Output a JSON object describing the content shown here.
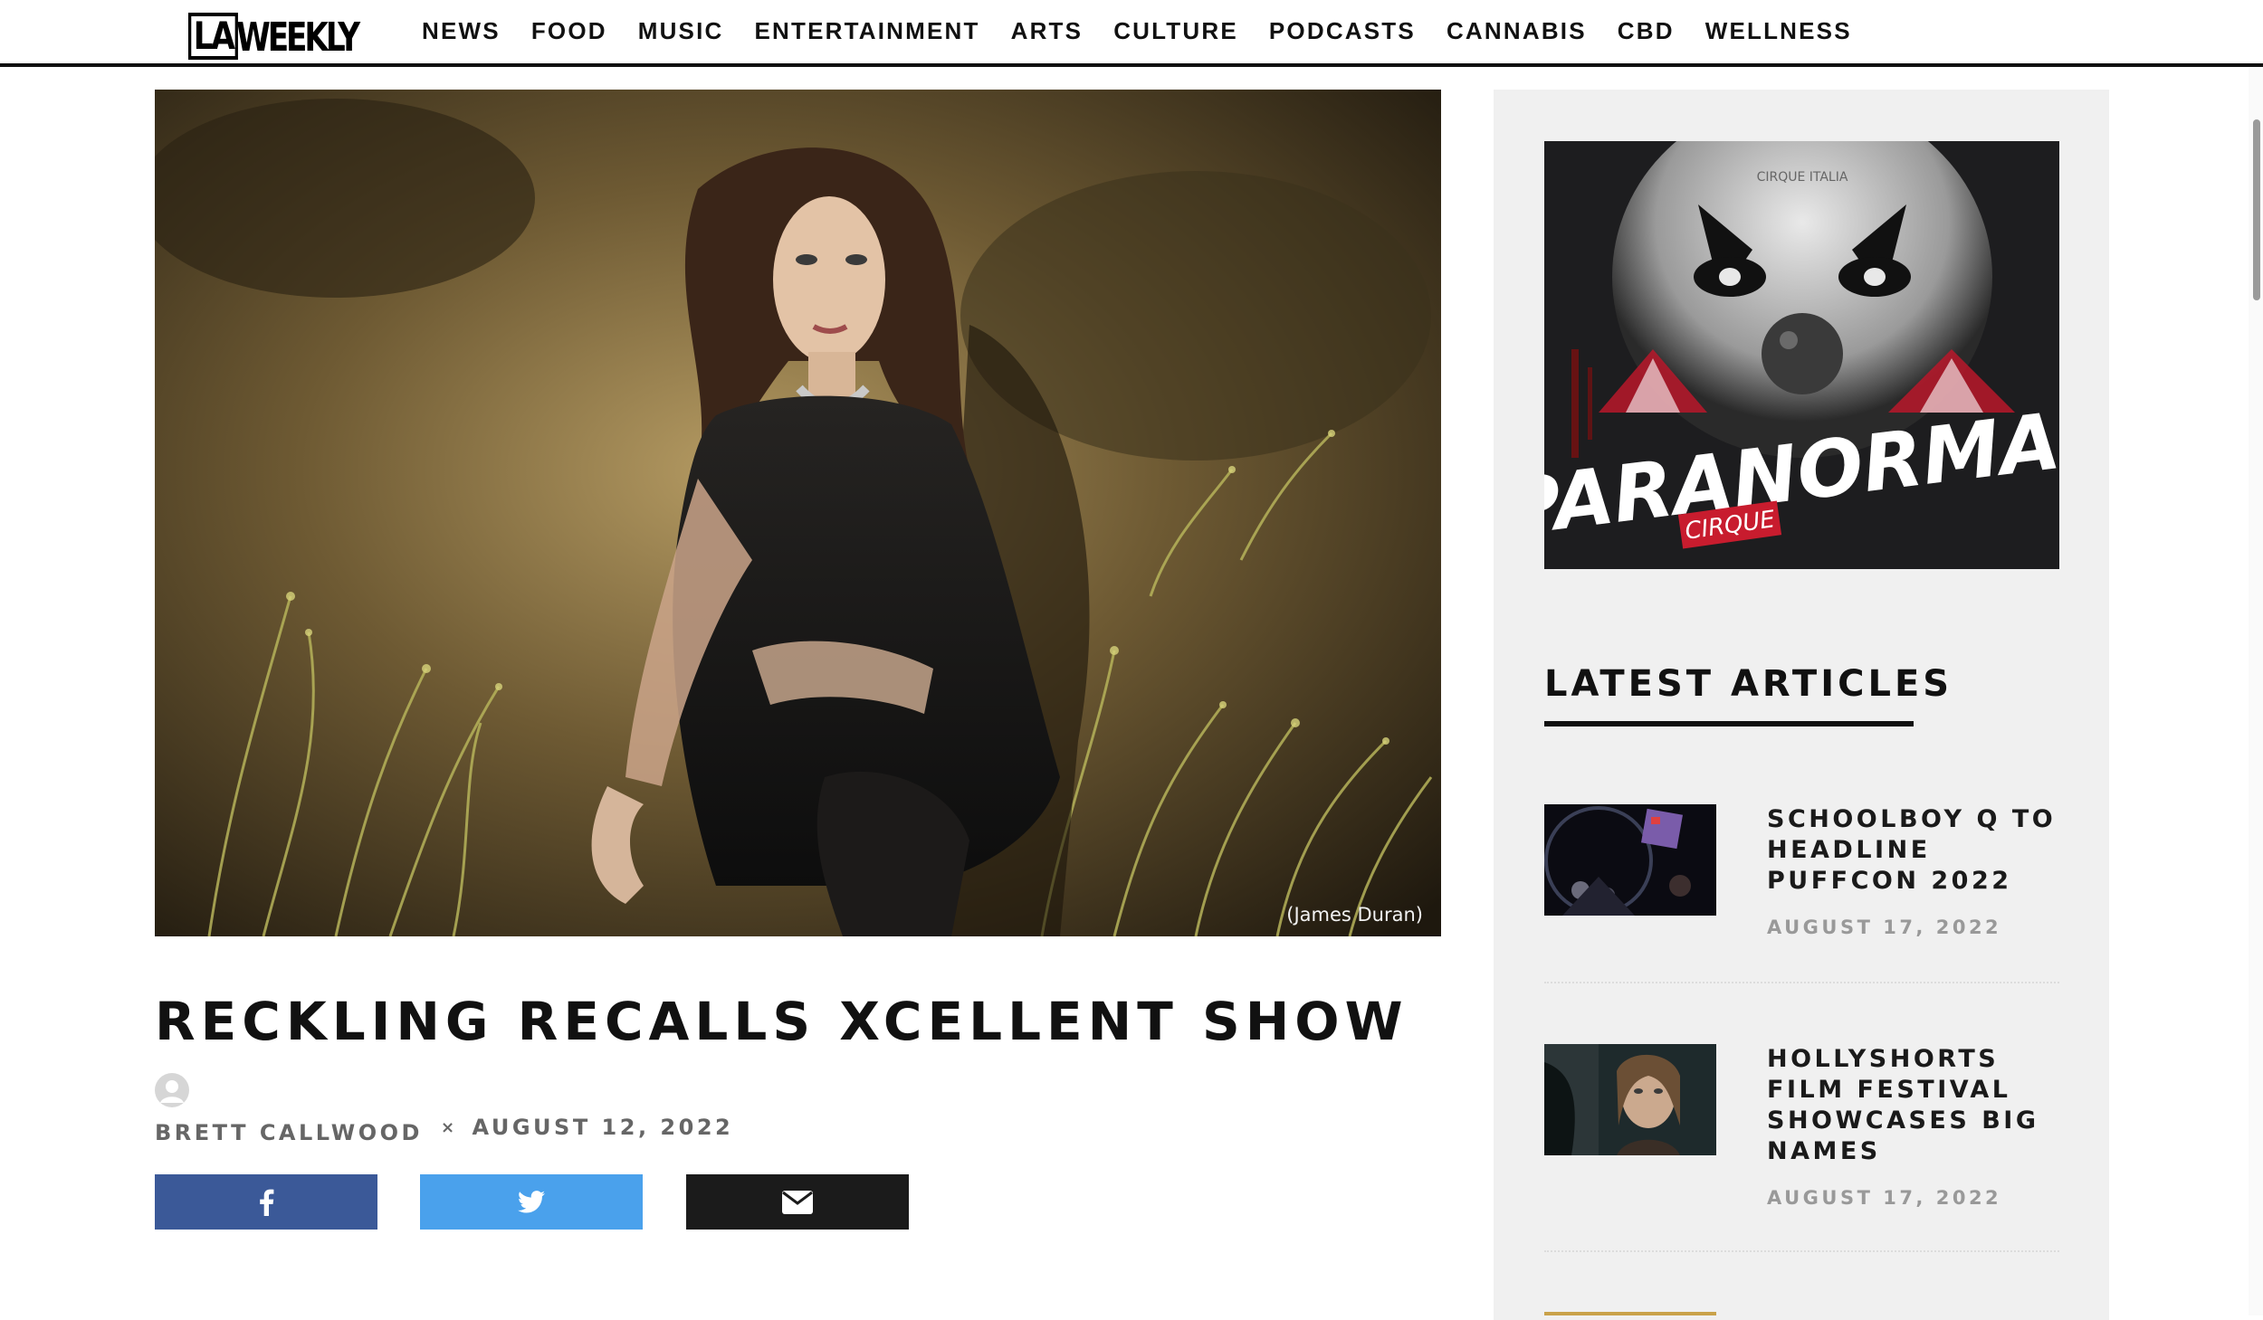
{
  "site": {
    "logo_la": "LA",
    "logo_weekly": "WEEKLY"
  },
  "nav": {
    "items": [
      "NEWS",
      "FOOD",
      "MUSIC",
      "ENTERTAINMENT",
      "ARTS",
      "CULTURE",
      "PODCASTS",
      "CANNABIS",
      "CBD",
      "WELLNESS"
    ]
  },
  "article": {
    "image_caption": "(James Duran)",
    "title": "RECKLING RECALLS XCELLENT SHOW",
    "author": "BRETT CALLWOOD",
    "separator": "×",
    "date": "AUGUST 12, 2022",
    "share": {
      "facebook_icon": "facebook-icon",
      "twitter_icon": "twitter-icon",
      "email_icon": "envelope-icon"
    },
    "colors": {
      "facebook": "#3b5998",
      "twitter": "#4aa1ec",
      "email": "#1b1b1b"
    }
  },
  "sidebar": {
    "ad": {
      "headline": "PARANORMAL",
      "subline": "CIRQUE",
      "top_text": "CIRQUE ITALIA"
    },
    "latest_title": "LATEST ARTICLES",
    "articles": [
      {
        "title": "SCHOOLBOY Q TO HEADLINE PUFFCON 2022",
        "date": "AUGUST 17, 2022"
      },
      {
        "title": "HOLLYSHORTS FILM FESTIVAL SHOWCASES BIG NAMES",
        "date": "AUGUST 17, 2022"
      }
    ]
  }
}
